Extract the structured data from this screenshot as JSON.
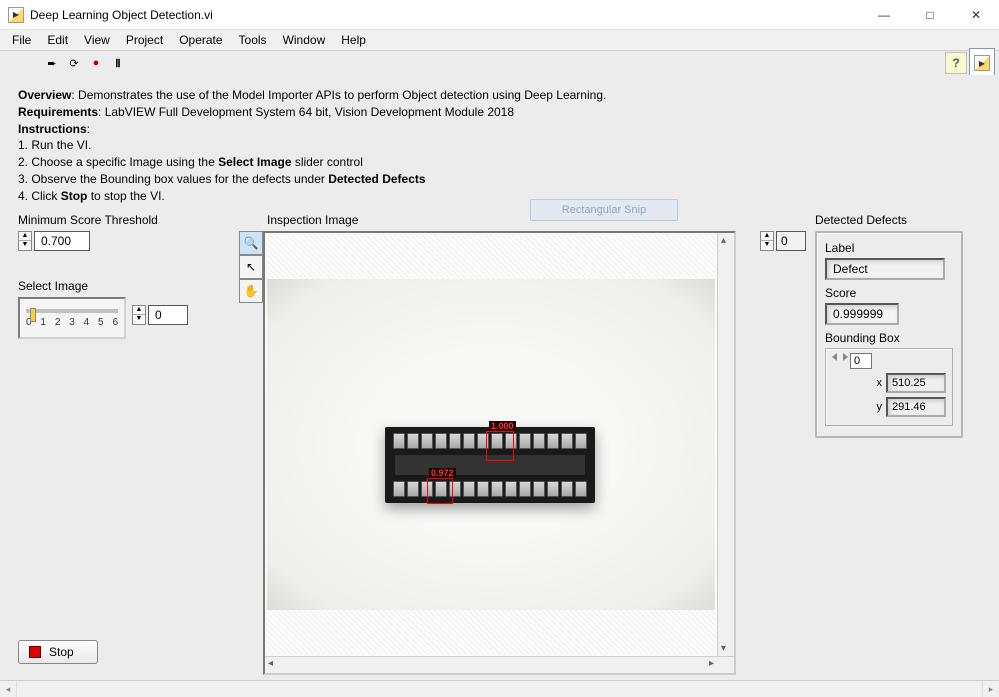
{
  "window": {
    "title": "Deep Learning Object Detection.vi"
  },
  "menu": [
    "File",
    "Edit",
    "View",
    "Project",
    "Operate",
    "Tools",
    "Window",
    "Help"
  ],
  "instructions": {
    "overview_label": "Overview",
    "overview_text": ": Demonstrates the use of the Model Importer APIs to perform Object detection using Deep Learning.",
    "requirements_label": "Requirements",
    "requirements_text": ": LabVIEW Full Development System 64 bit, Vision Development Module 2018",
    "instr_label": "Instructions",
    "step1": "1. Run the VI.",
    "step2a": "2. Choose a specific Image using the ",
    "step2b": "Select Image",
    "step2c": " slider control",
    "step3a": "3. Observe the Bounding box values for the defects under ",
    "step3b": "Detected Defects",
    "step4a": "4. Click ",
    "step4b": "Stop",
    "step4c": " to stop the VI."
  },
  "threshold": {
    "label": "Minimum Score Threshold",
    "value": "0.700"
  },
  "select_image": {
    "label": "Select Image",
    "value": "0",
    "ticks": [
      "0",
      "1",
      "2",
      "3",
      "4",
      "5",
      "6"
    ]
  },
  "stop": {
    "label": "Stop"
  },
  "inspection": {
    "label": "Inspection Image",
    "det_labels": {
      "a": "1.000",
      "b": "0.972"
    }
  },
  "array_index": {
    "value": "0"
  },
  "defects": {
    "label": "Detected Defects",
    "label_label": "Label",
    "label_value": "Defect",
    "score_label": "Score",
    "score_value": "0.999999",
    "bb_label": "Bounding Box",
    "bb_index": "0",
    "x_label": "x",
    "x_value": "510.25",
    "y_label": "y",
    "y_value": "291.46"
  },
  "snip": "Rectangular Snip"
}
